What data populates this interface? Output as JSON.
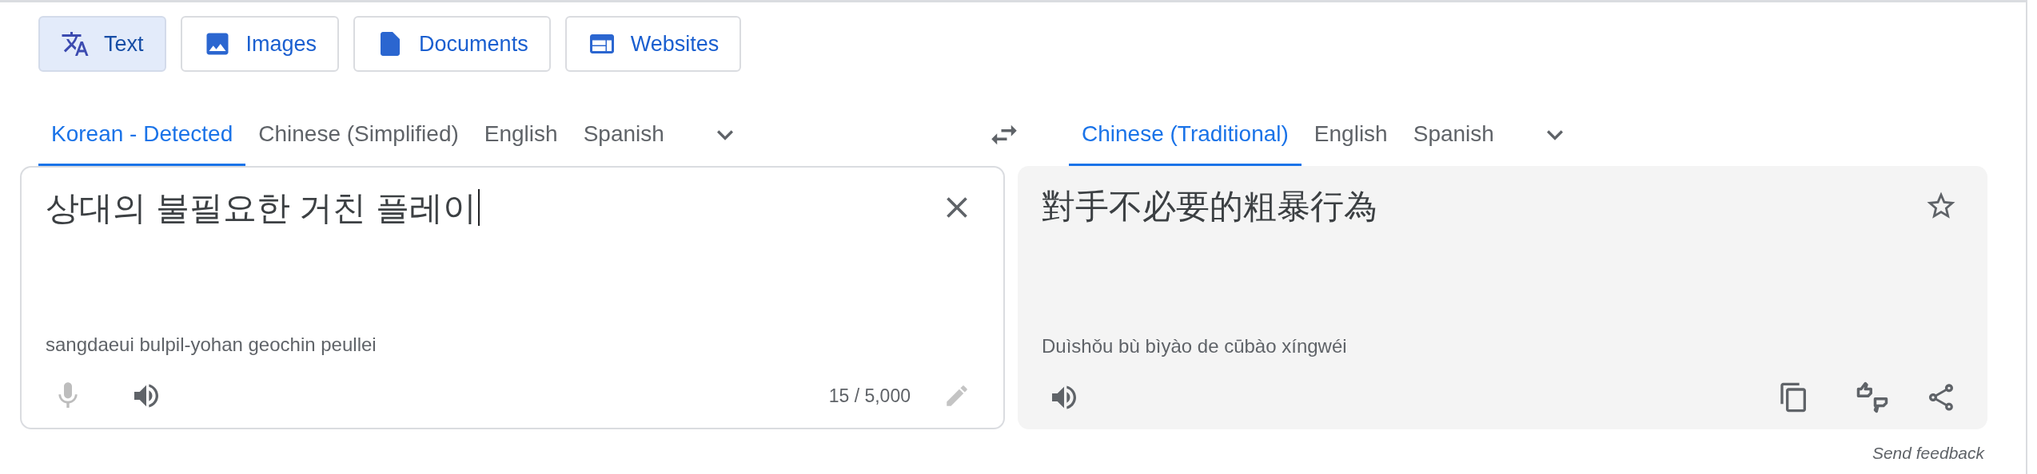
{
  "modes": [
    {
      "label": "Text",
      "kind": "text",
      "selected": true
    },
    {
      "label": "Images",
      "kind": "images",
      "selected": false
    },
    {
      "label": "Documents",
      "kind": "documents",
      "selected": false
    },
    {
      "label": "Websites",
      "kind": "websites",
      "selected": false
    }
  ],
  "source": {
    "languages": [
      {
        "label": "Korean - Detected",
        "selected": true
      },
      {
        "label": "Chinese (Simplified)",
        "selected": false
      },
      {
        "label": "English",
        "selected": false
      },
      {
        "label": "Spanish",
        "selected": false
      }
    ],
    "text": "상대의 불필요한 거친 플레이",
    "romanization": "sangdaeui bulpil-yohan geochin peullei",
    "char_count": "15 / 5,000",
    "mic_disabled": true
  },
  "target": {
    "languages": [
      {
        "label": "Chinese (Traditional)",
        "selected": true
      },
      {
        "label": "English",
        "selected": false
      },
      {
        "label": "Spanish",
        "selected": false
      }
    ],
    "text": "對手不必要的粗暴行為",
    "romanization": "Duìshǒu bù bìyào de cūbào xíngwéi"
  },
  "feedback": "Send feedback"
}
